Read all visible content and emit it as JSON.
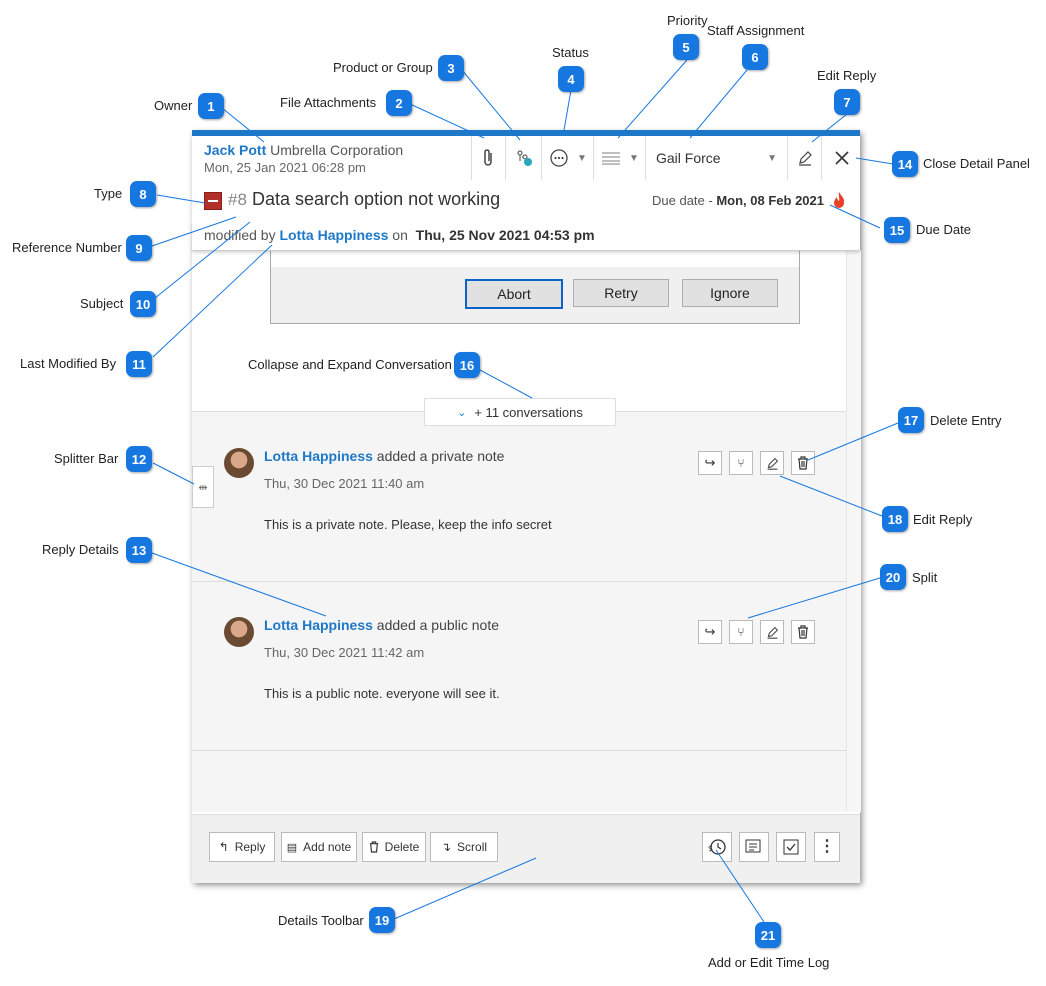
{
  "header": {
    "owner_name": "Jack Pott",
    "owner_org": "Umbrella Corporation",
    "owner_date": "Mon, 25 Jan 2021 06:28 pm",
    "staff": "Gail Force"
  },
  "ticket": {
    "ref": "#8",
    "subject": "Data search option not working",
    "due_label": "Due date -",
    "due_value": "Mon, 08 Feb 2021",
    "modified_prefix": "modified by",
    "modified_by": "Lotta Happiness",
    "modified_on": "on",
    "modified_when": "Thu, 25 Nov 2021 04:53 pm"
  },
  "dialog": {
    "abort": "Abort",
    "retry": "Retry",
    "ignore": "Ignore"
  },
  "conversations": {
    "label": "+ 11 conversations"
  },
  "notes": [
    {
      "author": "Lotta Happiness",
      "action": "added a private note",
      "date": "Thu, 30 Dec 2021 11:40 am",
      "body": "This is a private note. Please, keep the info secret"
    },
    {
      "author": "Lotta Happiness",
      "action": "added a public note",
      "date": "Thu, 30 Dec 2021 11:42 am",
      "body": "This is a public note. everyone will see it."
    }
  ],
  "toolbar": {
    "reply": "Reply",
    "add_note": "Add note",
    "delete": "Delete",
    "scroll": "Scroll"
  },
  "callouts": [
    {
      "num": "1",
      "label": "Owner"
    },
    {
      "num": "2",
      "label": "File Attachments"
    },
    {
      "num": "3",
      "label": "Product or Group"
    },
    {
      "num": "4",
      "label": "Status"
    },
    {
      "num": "5",
      "label": "Priority"
    },
    {
      "num": "6",
      "label": "Staff Assignment"
    },
    {
      "num": "7",
      "label": "Edit Reply"
    },
    {
      "num": "8",
      "label": "Type"
    },
    {
      "num": "9",
      "label": "Reference Number"
    },
    {
      "num": "10",
      "label": "Subject"
    },
    {
      "num": "11",
      "label": "Last Modified By"
    },
    {
      "num": "12",
      "label": "Splitter Bar"
    },
    {
      "num": "13",
      "label": "Reply Details"
    },
    {
      "num": "14",
      "label": "Close Detail Panel"
    },
    {
      "num": "15",
      "label": "Due Date"
    },
    {
      "num": "16",
      "label": "Collapse and Expand Conversation"
    },
    {
      "num": "17",
      "label": "Delete Entry"
    },
    {
      "num": "18",
      "label": "Edit Reply"
    },
    {
      "num": "19",
      "label": "Details Toolbar"
    },
    {
      "num": "20",
      "label": "Split"
    },
    {
      "num": "21",
      "label": "Add or Edit Time Log"
    }
  ],
  "colors": {
    "accent": "#1e78c8",
    "badge": "#1677e0",
    "type_red": "#b2302a",
    "fire": "#e8402a"
  }
}
